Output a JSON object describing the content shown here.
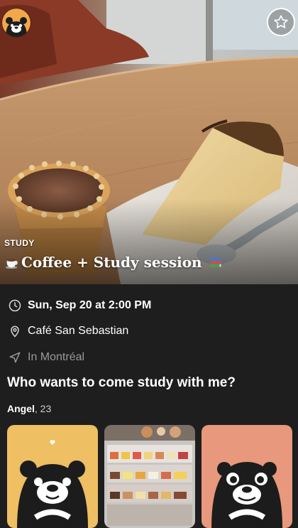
{
  "event": {
    "category": "STUDY",
    "title": "Coffee + Study session",
    "date_time": "Sun, Sep 20 at 2:00 PM",
    "venue": "Café San Sebastian",
    "city": "In Montréal",
    "description": "Who wants to come study with me?"
  },
  "host": {
    "name": "Angel",
    "age_suffix": ", 23"
  },
  "icons": {
    "top_left": "bear-logo-icon",
    "top_right": "star-icon",
    "title_start": "coffee-cup-icon",
    "title_end": "books-icon",
    "date": "clock-icon",
    "venue": "location-pin-icon",
    "city": "navigation-arrow-icon"
  },
  "colors": {
    "background": "#1e1e1f",
    "dim_text": "#9a9a9a",
    "gallery_yellow": "#eebf63",
    "gallery_salmon": "#e8987c",
    "logo_orange": "#f0a84a"
  }
}
